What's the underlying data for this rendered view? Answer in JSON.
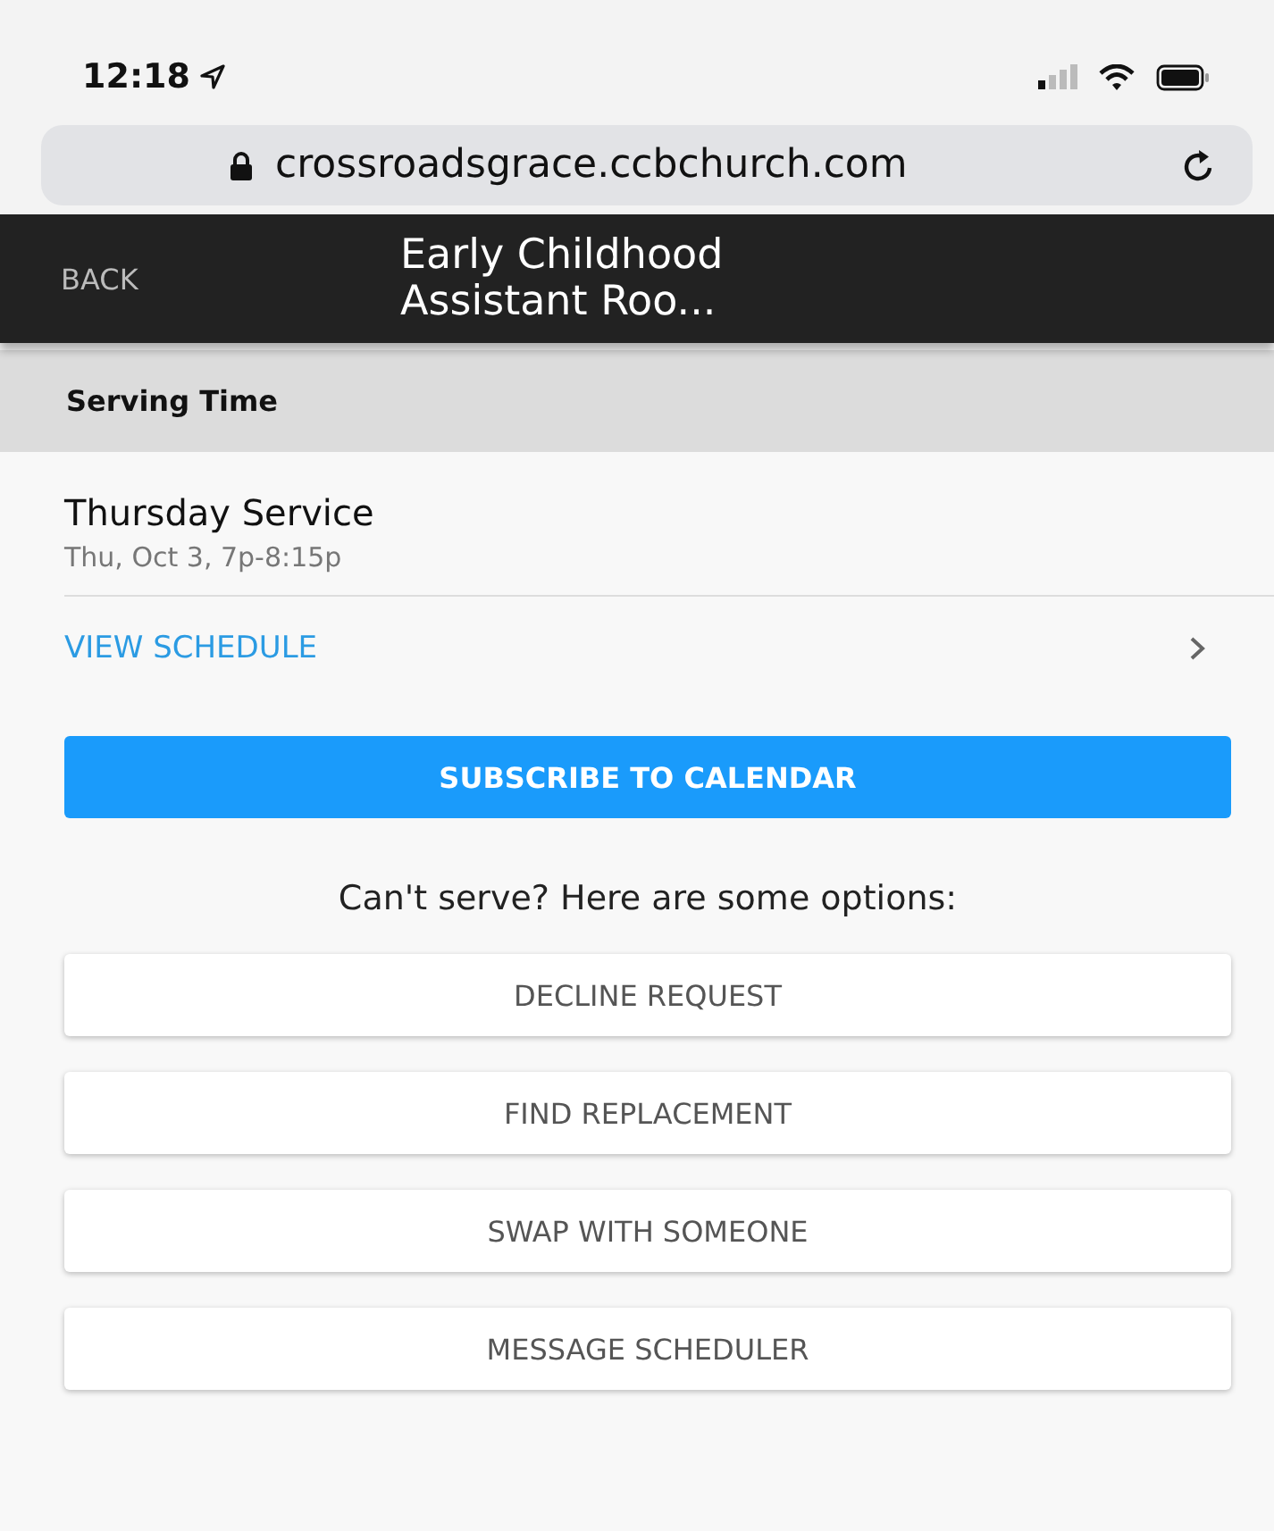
{
  "status_bar": {
    "time": "12:18"
  },
  "address_bar": {
    "url": "crossroadsgrace.ccbchurch.com"
  },
  "nav_bar": {
    "back": "BACK",
    "title_lines": [
      "Early Childhood",
      "Assistant Roo..."
    ]
  },
  "section": {
    "title": "Serving Time"
  },
  "event": {
    "name": "Thursday Service",
    "when": "Thu, Oct 3, 7p-8:15p"
  },
  "view_schedule": "VIEW SCHEDULE",
  "subscribe_button": "SUBSCRIBE TO CALENDAR",
  "options_prompt": "Can't serve? Here are some options:",
  "options": [
    "DECLINE REQUEST",
    "FIND REPLACEMENT",
    "SWAP WITH SOMEONE",
    "MESSAGE SCHEDULER"
  ]
}
